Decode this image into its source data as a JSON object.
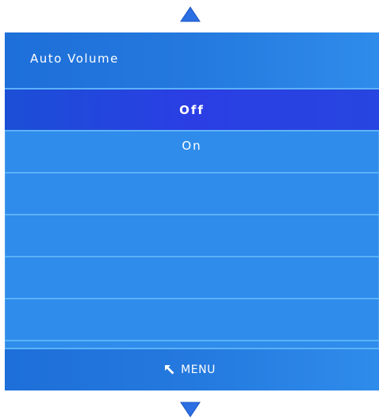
{
  "menu": {
    "title": "Auto Volume",
    "options": [
      {
        "label": "Off",
        "selected": true
      },
      {
        "label": "On",
        "selected": false
      },
      {
        "label": "",
        "selected": false
      },
      {
        "label": "",
        "selected": false
      },
      {
        "label": "",
        "selected": false
      },
      {
        "label": "",
        "selected": false
      }
    ],
    "footer": {
      "icon": "return-arrow-icon",
      "label": "MENU"
    }
  },
  "navigation": {
    "up_icon": "triangle-up-icon",
    "down_icon": "triangle-down-icon"
  },
  "colors": {
    "panel": "#2f8ceb",
    "selected_row": "#2a3ee4",
    "separator": "#5cb2f7",
    "arrow": "#2c6fe3"
  }
}
